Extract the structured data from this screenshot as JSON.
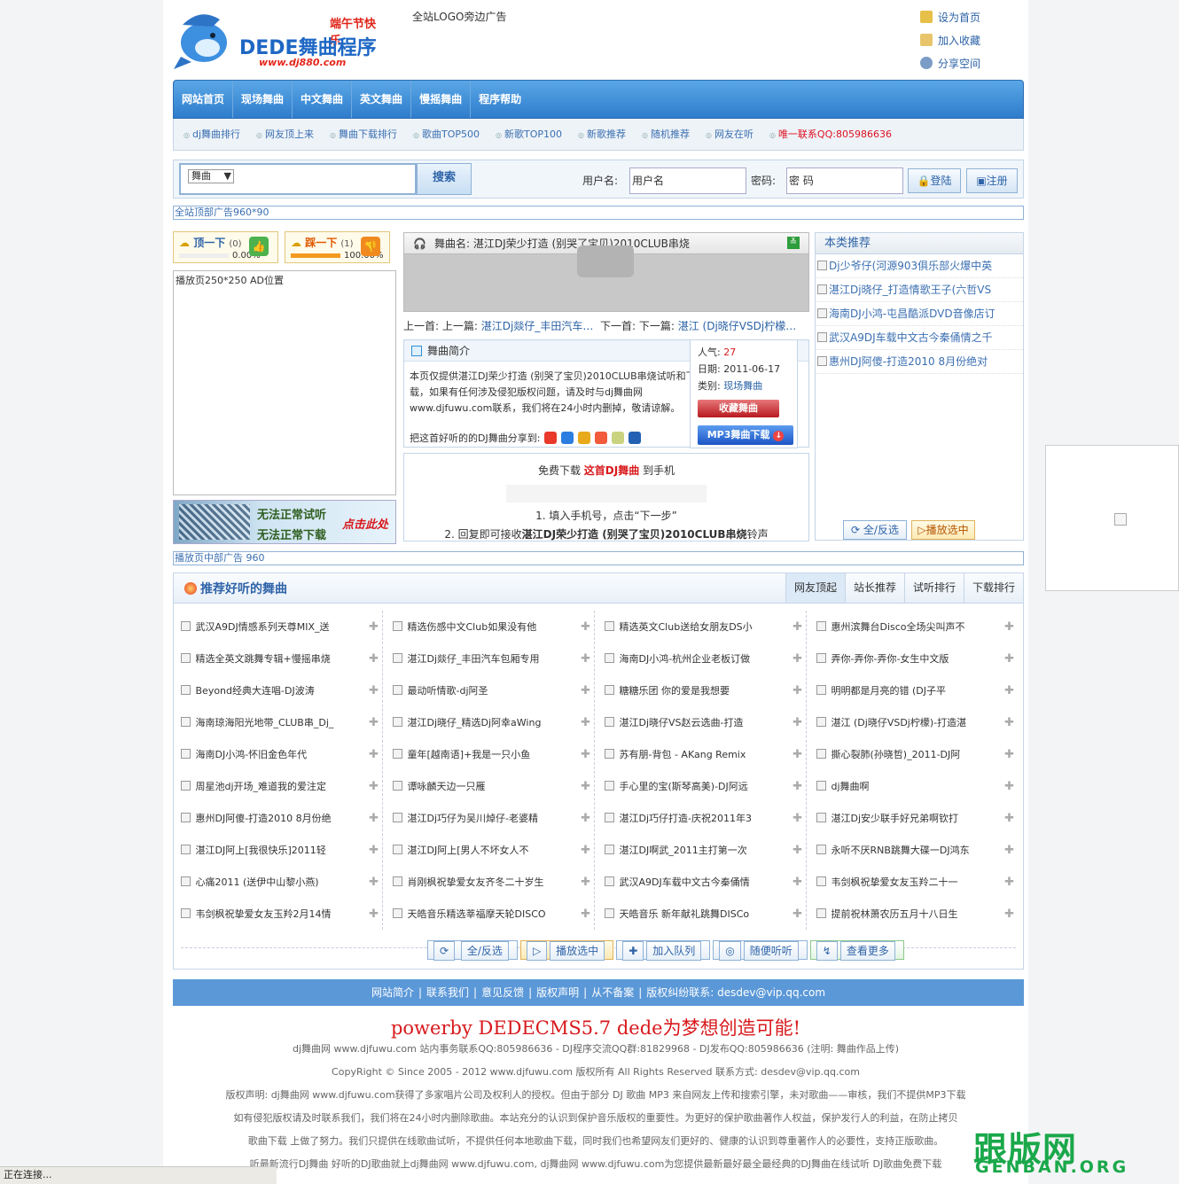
{
  "header": {
    "logo_main": "DEDE舞曲程序",
    "logo_tag": "端午节快乐",
    "logo_url": "www.dj880.com",
    "logo_ad": "全站LOGO旁边广告",
    "toplinks": [
      "设为首页",
      "加入收藏",
      "分享空间"
    ]
  },
  "nav": [
    "网站首页",
    "现场舞曲",
    "中文舞曲",
    "英文舞曲",
    "慢摇舞曲",
    "程序帮助"
  ],
  "subnav": [
    "dj舞曲排行",
    "网友顶上来",
    "舞曲下载排行",
    "歌曲TOP500",
    "新歌TOP100",
    "新歌推荐",
    "随机推荐",
    "网友在听",
    "唯一联系QQ:805986636"
  ],
  "search": {
    "select_value": "舞曲",
    "button": "搜索",
    "username_label": "用户名:",
    "username_value": "用户名",
    "password_label": "密码:",
    "password_value": "密 码",
    "login": "登陆",
    "register": "注册"
  },
  "ads": {
    "top": "全站顶部广告960*90",
    "middle": "播放页中部广告 960",
    "left": "播放页250*250 AD位置"
  },
  "votes": {
    "up_label": "顶一下",
    "up_count": "(0)",
    "up_pct": "0.00%",
    "up_level": 0,
    "down_label": "踩一下",
    "down_count": "(1)",
    "down_pct": "100.00%",
    "down_level": 1
  },
  "warn": {
    "line1": "无法正常试听",
    "line2": "无法正常下载",
    "click": "点击此处"
  },
  "player": {
    "title": "舞曲名: 湛江DJ荣少打造 (别哭了宝贝)2010CLUB串烧",
    "prev_label": "上一首:",
    "prev_inner": "上一篇:",
    "prev_link": "湛江Dj燚仔_丰田汽车…",
    "next_label": "下一首:",
    "next_inner": "下一篇:",
    "next_link": "湛江 (Dj晓仔VSDj柠檬…"
  },
  "intro": {
    "heading": "舞曲简介",
    "text": "本页仅提供湛江DJ荣少打造 (别哭了宝贝)2010CLUB串烧试听和下载，如果有任何涉及侵犯版权问题，请及时与dj舞曲网www.djfuwu.com联系，我们将在24小时内删掉，敬请谅解。",
    "share_label": "把这首好听的的DJ舞曲分享到:",
    "pop_label": "人气:",
    "pop_value": "27",
    "date_label": "日期:",
    "date_value": "2011-06-17",
    "cat_label": "类别:",
    "cat_value": "现场舞曲",
    "collect_btn": "收藏舞曲",
    "download_btn": "MP3舞曲下载"
  },
  "mobile": {
    "line_a": "免费下载",
    "line_b": "这首DJ舞曲",
    "line_c": "到手机",
    "step1": "1. 填入手机号，点击“下一步”",
    "step2_a": "2. 回复即可接收",
    "step2_b": "湛江DJ荣少打造 (别哭了宝贝)2010CLUB串烧",
    "step2_c": "铃声"
  },
  "recommend": {
    "title": "本类推荐",
    "items": [
      "Dj少爷仔(河源903俱乐部火爆中英",
      "湛江Dj晓仔_打造情歌王子(六哲VS",
      "海南DJ小鸿-屯昌酷派DVD音像店订",
      "武汉A9DJ车载中文古今秦俑情之千",
      "惠州DJ阿傻-打造2010 8月份绝对"
    ],
    "btn_all": "全/反选",
    "btn_play": "播放选中"
  },
  "biglist": {
    "title": "推荐好听的舞曲",
    "tabs": [
      "网友顶起",
      "站长推荐",
      "试听排行",
      "下载排行"
    ],
    "columns": [
      [
        "武汉A9DJ情感系列天尊MIX_送",
        "精选全英文跳舞专辑+慢摇串烧",
        "Beyond经典大连唱-DJ波涛",
        "海南琼海阳光地带_CLUB串_Dj_",
        "海南DJ小鸿-怀旧金色年代",
        "周星池dj开场_难道我的爱注定",
        "惠州DJ阿傻-打造2010 8月份绝",
        "湛江DJ阿上[我很快乐]2011轻",
        "心痛2011 (送伊中山黎小燕)",
        "韦剑枫祝挚爱女友玉羚2月14情"
      ],
      [
        "精选伤感中文Club如果没有他",
        "湛江Dj燚仔_丰田汽车包厢专用",
        "最动听情歌-dj阿圣",
        "湛江Dj晓仔_精选Dj阿幸aWing",
        "童年[越南语]+我是一只小鱼",
        "谭咏麟天边一只雁",
        "湛江Dj巧仔为吴川焯仔-老婆精",
        "湛江DJ阿上[男人不坏女人不",
        "肖刚枫祝挚爱女友齐冬二十岁生",
        "天皓音乐精选莘福摩天轮DISCO"
      ],
      [
        "精选英文Club送给女朋友DS小",
        "海南DJ小鸿-杭州企业老板订做",
        "糖糖乐团 你的爱是我想要",
        "湛江Dj晓仔VS赵云选曲-打造",
        "苏有朋-背包 - AKang Remix",
        "手心里的宝(斯琴高美)-DJ阿远",
        "湛江Dj巧仔打造-庆祝2011年3",
        "湛江DJ啊武_2011主打第一次",
        "武汉A9DJ车载中文古今秦俑情",
        "天皓音乐 新年献礼跳舞DISCo"
      ],
      [
        "惠州滨舞台Disco全场尖叫声不",
        "弄你-弄你-弄你-女生中文版",
        "明明都是月亮的错 (DJ子平",
        "湛江 (Dj晓仔VSDj柠檬)-打造湛",
        "撕心裂肺(孙晓哲)_2011-DJ阿",
        "dj舞曲啊",
        "湛江Dj安少联手好兄弟啊钦打",
        "永听不厌RNB跳舞大碟一DJ鸿东",
        "韦剑枫祝挚爱女友玉羚二十一",
        "提前祝林萧农历五月十八日生"
      ]
    ],
    "buttons": [
      "全/反选",
      "播放选中",
      "加入队列",
      "随便听听",
      "查看更多"
    ]
  },
  "footer": {
    "nav": [
      "网站简介",
      "联系我们",
      "意见反馈",
      "版权声明",
      "从不备案",
      "版权纠纷联系: desdev@vip.qq.com"
    ],
    "powerby": "powerby DEDECMS5.7 dede为梦想创造可能!",
    "line1": "dj舞曲网 www.djfuwu.com 站内事务联系QQ:805986636 - DJ程序交流QQ群:81829968 - DJ发布QQ:805986636 (注明: 舞曲作品上传)",
    "line2": "CopyRight © Since 2005 - 2012          www.djfuwu.com 版权所有 All Rights Reserved 联系方式: desdev@vip.qq.com",
    "line3": "版权声明: dj舞曲网 www.djfuwu.com获得了多家唱片公司及权利人的授权。但由于部分 DJ 歌曲 MP3 来自网友上传和搜索引擎，未对歌曲——审核，我们不提供MP3下载",
    "line4": "如有侵犯版权请及时联系我们，我们将在24小时内删除歌曲。本站充分的认识到保护音乐版权的重要性。为更好的保护歌曲著作人权益，保护发行人的利益，在防止拷贝",
    "line5": "歌曲下载 上做了努力。我们只提供在线歌曲试听，不提供任何本地歌曲下载，同时我们也希望网友们更好的、健康的认识到尊重著作人的必要性，支持正版歌曲。",
    "line6": "听最新流行DJ舞曲 好听的DJ歌曲就上dj舞曲网 www.djfuwu.com, dj舞曲网 www.djfuwu.com为您提供最新最好最全最经典的DJ舞曲在线试听 DJ歌曲免费下载"
  },
  "status_text": "正在连接...",
  "watermark": {
    "main": "跟版网",
    "sub": "GENBAN.ORG"
  }
}
